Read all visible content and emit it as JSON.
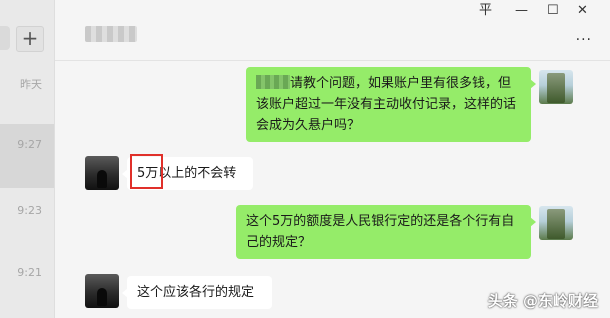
{
  "window_controls": {
    "pin": "平",
    "minimize": "—",
    "maximize": "☐",
    "close": "✕"
  },
  "sidebar": {
    "add_label": "+",
    "items": [
      {
        "time": "昨天"
      },
      {
        "time": "9:27"
      },
      {
        "time": "9:23"
      },
      {
        "time": "9:21"
      }
    ]
  },
  "header": {
    "contact_name": "",
    "more_label": "···"
  },
  "messages": [
    {
      "sender": "me",
      "text_prefix": "",
      "text": "请教个问题，如果账户里有很多钱，但该账户超过一年没有主动收付记录，这样的话会成为久悬户吗？"
    },
    {
      "sender": "other",
      "text": "5万以上的不会转"
    },
    {
      "sender": "me",
      "text": "这个5万的额度是人民银行定的还是各个行有自己的规定？"
    },
    {
      "sender": "other",
      "text": "这个应该各行的规定"
    }
  ],
  "watermark": "头条 @东岭财经"
}
